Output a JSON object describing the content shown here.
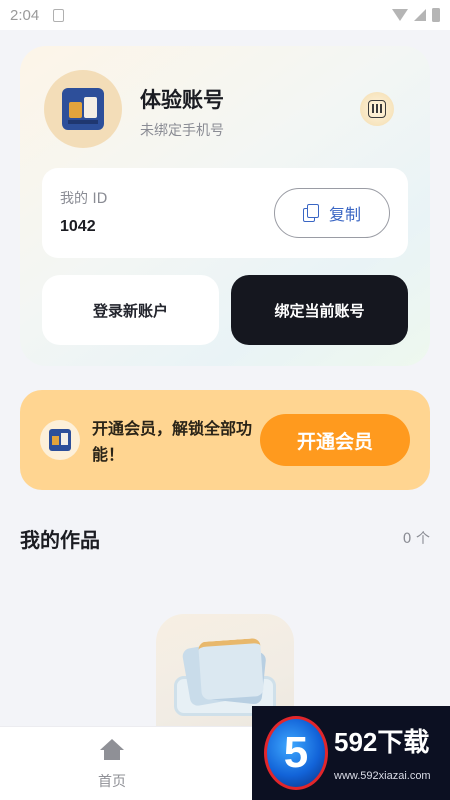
{
  "status_bar": {
    "time": "2:04"
  },
  "profile": {
    "account_name": "体验账号",
    "phone_status": "未绑定手机号",
    "id_label": "我的 ID",
    "id_value": "1042",
    "copy_label": "复制",
    "login_label": "登录新账户",
    "bind_label": "绑定当前账号"
  },
  "vip": {
    "text": "开通会员，解锁全部功能！",
    "button_label": "开通会员",
    "accent_color": "#ff9a1e",
    "banner_color": "#ffd591"
  },
  "works": {
    "title": "我的作品",
    "count": "0 个"
  },
  "bottom_nav": {
    "items": [
      {
        "label": "首页",
        "icon": "home-icon"
      }
    ]
  },
  "watermark": {
    "badge": "5",
    "brand": "592下载",
    "url": "www.592xiazai.com"
  }
}
